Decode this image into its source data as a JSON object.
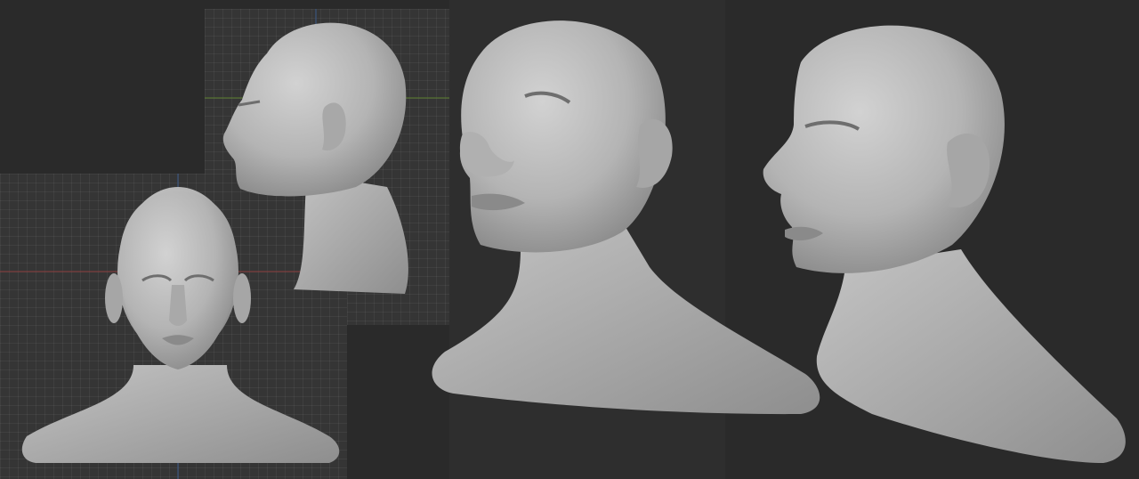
{
  "viewports": [
    {
      "id": "side",
      "view": "side",
      "grid": true
    },
    {
      "id": "front",
      "view": "front",
      "grid": true
    },
    {
      "id": "three-quarter-left",
      "view": "perspective",
      "grid": false
    },
    {
      "id": "three-quarter-right",
      "view": "perspective",
      "grid": false
    }
  ],
  "colors": {
    "background": "#2a2a2a",
    "grid_bg": "#353535",
    "axis_x": "#8a3b3b",
    "axis_y": "#5b7f2f",
    "axis_z": "#3b5a8a",
    "clay": "#bdbdbd",
    "clay_shadow": "#7a7a7a"
  }
}
